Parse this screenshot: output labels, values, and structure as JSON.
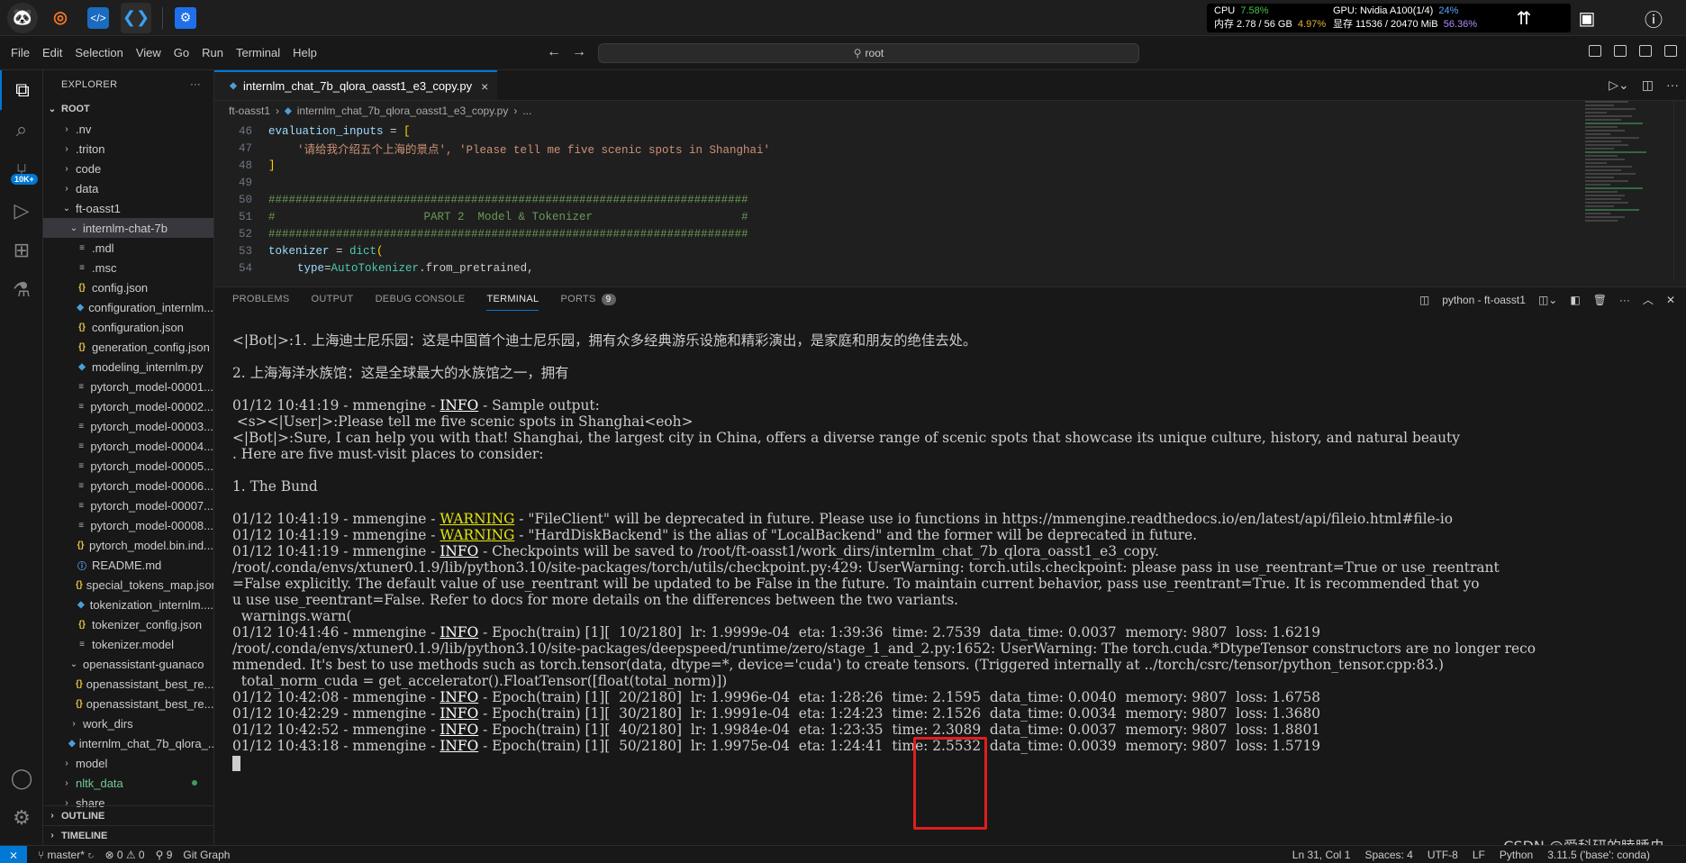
{
  "system_monitor": {
    "cpu_label": "CPU",
    "cpu_value": "7.58%",
    "mem_label": "内存 2.78 / 56 GB",
    "mem_value": "4.97%",
    "gpu_label": "GPU: Nvidia A100(1/4)",
    "gpu_value": "24%",
    "vram_label": "显存 11536 / 20470 MiB",
    "vram_value": "56.36%"
  },
  "menu": [
    "File",
    "Edit",
    "Selection",
    "View",
    "Go",
    "Run",
    "Terminal",
    "Help"
  ],
  "search": {
    "text": "root"
  },
  "explorer": {
    "title": "EXPLORER",
    "root_label": "ROOT",
    "items": [
      {
        "label": ".nv",
        "kind": "folder"
      },
      {
        "label": ".triton",
        "kind": "folder"
      },
      {
        "label": "code",
        "kind": "folder"
      },
      {
        "label": "data",
        "kind": "folder"
      },
      {
        "label": "ft-oasst1",
        "kind": "folder-open"
      },
      {
        "label": "internlm-chat-7b",
        "kind": "folder-open"
      },
      {
        "label": ".mdl",
        "kind": "eq"
      },
      {
        "label": ".msc",
        "kind": "eq"
      },
      {
        "label": "config.json",
        "kind": "json"
      },
      {
        "label": "configuration_internlm...",
        "kind": "py"
      },
      {
        "label": "configuration.json",
        "kind": "json"
      },
      {
        "label": "generation_config.json",
        "kind": "json"
      },
      {
        "label": "modeling_internlm.py",
        "kind": "py"
      },
      {
        "label": "pytorch_model-00001...",
        "kind": "eq"
      },
      {
        "label": "pytorch_model-00002...",
        "kind": "eq"
      },
      {
        "label": "pytorch_model-00003...",
        "kind": "eq"
      },
      {
        "label": "pytorch_model-00004...",
        "kind": "eq"
      },
      {
        "label": "pytorch_model-00005...",
        "kind": "eq"
      },
      {
        "label": "pytorch_model-00006...",
        "kind": "eq"
      },
      {
        "label": "pytorch_model-00007...",
        "kind": "eq"
      },
      {
        "label": "pytorch_model-00008...",
        "kind": "eq"
      },
      {
        "label": "pytorch_model.bin.ind...",
        "kind": "json"
      },
      {
        "label": "README.md",
        "kind": "info"
      },
      {
        "label": "special_tokens_map.json",
        "kind": "json"
      },
      {
        "label": "tokenization_internlm....",
        "kind": "py"
      },
      {
        "label": "tokenizer_config.json",
        "kind": "json"
      },
      {
        "label": "tokenizer.model",
        "kind": "eq"
      },
      {
        "label": "openassistant-guanaco",
        "kind": "folder-open"
      },
      {
        "label": "openassistant_best_re...",
        "kind": "json"
      },
      {
        "label": "openassistant_best_re...",
        "kind": "json"
      },
      {
        "label": "work_dirs",
        "kind": "folder"
      },
      {
        "label": "internlm_chat_7b_qlora_...",
        "kind": "py"
      },
      {
        "label": "model",
        "kind": "folder"
      },
      {
        "label": "nltk_data",
        "kind": "folder-green"
      },
      {
        "label": "share",
        "kind": "folder"
      }
    ],
    "outline_label": "OUTLINE",
    "timeline_label": "TIMELINE"
  },
  "editor": {
    "tab_label": "internlm_chat_7b_qlora_oasst1_e3_copy.py",
    "breadcrumb_folder": "ft-oasst1",
    "breadcrumb_file": "internlm_chat_7b_qlora_oasst1_e3_copy.py",
    "breadcrumb_more": "...",
    "lines": [
      {
        "num": "46",
        "text": "evaluation_inputs = ["
      },
      {
        "num": "47",
        "text": "'请给我介绍五个上海的景点', 'Please tell me five scenic spots in Shanghai'"
      },
      {
        "num": "48",
        "text": "]"
      },
      {
        "num": "49",
        "text": ""
      },
      {
        "num": "50",
        "text": "#######################################################################"
      },
      {
        "num": "51",
        "text": "#                      PART 2  Model & Tokenizer                      #"
      },
      {
        "num": "52",
        "text": "#######################################################################"
      },
      {
        "num": "53",
        "text": "tokenizer = dict("
      },
      {
        "num": "54",
        "text": "type=AutoTokenizer.from_pretrained,"
      }
    ]
  },
  "panel": {
    "tabs": [
      "PROBLEMS",
      "OUTPUT",
      "DEBUG CONSOLE",
      "TERMINAL",
      "PORTS"
    ],
    "ports_count": "9",
    "terminal_name": "python - ft-oasst1"
  },
  "terminal": {
    "l1": "<|Bot|>:1. 上海迪士尼乐园：这是中国首个迪士尼乐园，拥有众多经典游乐设施和精彩演出，是家庭和朋友的绝佳去处。",
    "l2": "2. 上海海洋水族馆：这是全球最大的水族馆之一，拥有",
    "l3_pre": "01/12 10:41:19 - mmengine - ",
    "l3_tag": "INFO",
    "l3_post": " - Sample output:",
    "l4": " <s><|User|>:Please tell me five scenic spots in Shanghai<eoh>",
    "l5": "<|Bot|>:Sure, I can help you with that! Shanghai, the largest city in China, offers a diverse range of scenic spots that showcase its unique culture, history, and natural beauty",
    "l6": ". Here are five must-visit places to consider:",
    "l7": "1. The Bund",
    "l8_pre": "01/12 10:41:19 - mmengine - ",
    "l8_tag": "WARNING",
    "l8_post": " - \"FileClient\" will be deprecated in future. Please use io functions in https://mmengine.readthedocs.io/en/latest/api/fileio.html#file-io",
    "l9_pre": "01/12 10:41:19 - mmengine - ",
    "l9_tag": "WARNING",
    "l9_post": " - \"HardDiskBackend\" is the alias of \"LocalBackend\" and the former will be deprecated in future.",
    "l10_pre": "01/12 10:41:19 - mmengine - ",
    "l10_tag": "INFO",
    "l10_post": " - Checkpoints will be saved to /root/ft-oasst1/work_dirs/internlm_chat_7b_qlora_oasst1_e3_copy.",
    "l11": "/root/.conda/envs/xtuner0.1.9/lib/python3.10/site-packages/torch/utils/checkpoint.py:429: UserWarning: torch.utils.checkpoint: please pass in use_reentrant=True or use_reentrant",
    "l12": "=False explicitly. The default value of use_reentrant will be updated to be False in the future. To maintain current behavior, pass use_reentrant=True. It is recommended that yo",
    "l13": "u use use_reentrant=False. Refer to docs for more details on the differences between the two variants.",
    "l14": "  warnings.warn(",
    "l15_pre": "01/12 10:41:46 - mmengine - ",
    "l15_tag": "INFO",
    "l15_post": " - Epoch(train) [1][  10/2180]  lr: 1.9999e-04  eta: 1:39:36  time: 2.7539  data_time: 0.0037  memory: 9807  loss: 1.6219",
    "l16": "/root/.conda/envs/xtuner0.1.9/lib/python3.10/site-packages/deepspeed/runtime/zero/stage_1_and_2.py:1652: UserWarning: The torch.cuda.*DtypeTensor constructors are no longer reco",
    "l17": "mmended. It's best to use methods such as torch.tensor(data, dtype=*, device='cuda') to create tensors. (Triggered internally at ../torch/csrc/tensor/python_tensor.cpp:83.)",
    "l18": "  total_norm_cuda = get_accelerator().FloatTensor([float(total_norm)])",
    "l19_pre": "01/12 10:42:08 - mmengine - ",
    "l19_tag": "INFO",
    "l19_post": " - Epoch(train) [1][  20/2180]  lr: 1.9996e-04  eta: 1:28:26  time: 2.1595  data_time: 0.0040  memory: 9807  loss: 1.6758",
    "l20_pre": "01/12 10:42:29 - mmengine - ",
    "l20_tag": "INFO",
    "l20_post": " - Epoch(train) [1][  30/2180]  lr: 1.9991e-04  eta: 1:24:23  time: 2.1526  data_time: 0.0034  memory: 9807  loss: 1.3680",
    "l21_pre": "01/12 10:42:52 - mmengine - ",
    "l21_tag": "INFO",
    "l21_post": " - Epoch(train) [1][  40/2180]  lr: 1.9984e-04  eta: 1:23:35  time: 2.3089  data_time: 0.0037  memory: 9807  loss: 1.8801",
    "l22_pre": "01/12 10:43:18 - mmengine - ",
    "l22_tag": "INFO",
    "l22_post": " - Epoch(train) [1][  50/2180]  lr: 1.9975e-04  eta: 1:24:41  time: 2.5532  data_time: 0.0039  memory: 9807  loss: 1.5719"
  },
  "statusbar": {
    "branch": "master*",
    "problems": "⊗ 0 ⚠ 0",
    "ports": "9",
    "git_graph": "Git Graph",
    "position": "Ln 31, Col 1",
    "spaces": "Spaces: 4",
    "encoding": "UTF-8",
    "eol": "LF",
    "language": "Python",
    "interpreter": "3.11.5 ('base': conda)"
  },
  "watermark": "CSDN @爱科研的瞌睡虫",
  "colors": {
    "accent": "#0078d4",
    "highlight_box": "#e01e1e",
    "warning": "#e5e510"
  }
}
